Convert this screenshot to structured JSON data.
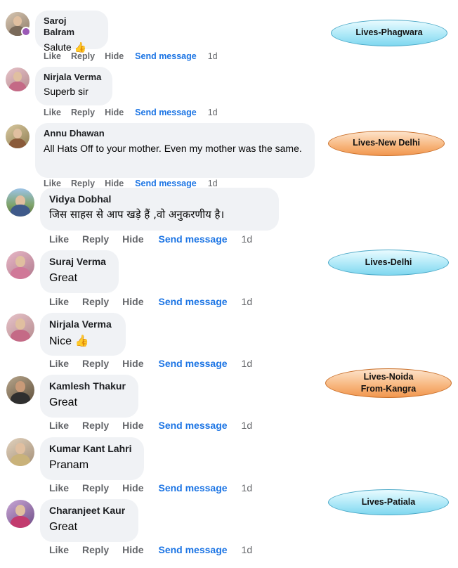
{
  "actions": {
    "like": "Like",
    "reply": "Reply",
    "hide": "Hide",
    "send_message": "Send message",
    "time": "1d"
  },
  "comments": [
    {
      "name": "Saroj Balram",
      "text": "Salute",
      "emoji": "👍"
    },
    {
      "name": "Nirjala Verma",
      "text": "Superb sir",
      "emoji": ""
    },
    {
      "name": "Annu Dhawan",
      "text": "All Hats Off to your mother. Even my mother was the same.",
      "emoji": ""
    },
    {
      "name": "Vidya Dobhal",
      "text": "जिस साहस से आप खड़े हैं ,वो अनुकरणीय है।",
      "emoji": ""
    },
    {
      "name": "Suraj Verma",
      "text": "Great",
      "emoji": ""
    },
    {
      "name": "Nirjala Verma",
      "text": "Nice",
      "emoji": "👍"
    },
    {
      "name": "Kamlesh Thakur",
      "text": "Great",
      "emoji": ""
    },
    {
      "name": "Kumar Kant Lahri",
      "text": "Pranam",
      "emoji": ""
    },
    {
      "name": "Charanjeet Kaur",
      "text": "Great",
      "emoji": ""
    }
  ],
  "tags": [
    {
      "lines": [
        "Lives-Phagwara"
      ],
      "style": "blue"
    },
    {
      "lines": [
        "Lives-New Delhi"
      ],
      "style": "orange"
    },
    {
      "lines": [
        "Lives-Delhi"
      ],
      "style": "blue"
    },
    {
      "lines": [
        "Lives-Noida",
        "From-Kangra"
      ],
      "style": "orange"
    },
    {
      "lines": [
        "Lives-Patiala"
      ],
      "style": "blue"
    }
  ],
  "colors": {
    "bubble": "#f0f2f5",
    "action_text": "#65676b",
    "link_blue": "#1b74e4",
    "tag_blue": "#a9e7f7",
    "tag_orange": "#f7b57c"
  }
}
